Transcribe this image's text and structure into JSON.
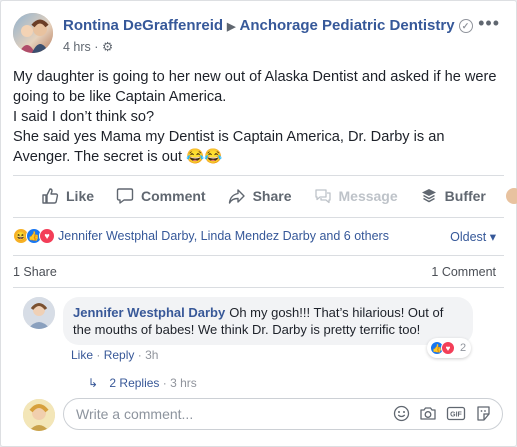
{
  "post": {
    "author": "Rontina DeGraffenreid",
    "page": "Anchorage Pediatric Dentistry",
    "time": "4 hrs",
    "privacy_separator": "·",
    "body_lines": [
      "My daughter is going to her new out of Alaska Dentist and asked if he were going to be like Captain America.",
      "I said I don’t think so?",
      "She said yes Mama my Dentist is Captain America, Dr. Darby is an Avenger. The secret is out 😂😂"
    ]
  },
  "actions": {
    "like": "Like",
    "comment": "Comment",
    "share": "Share",
    "message": "Message",
    "buffer": "Buffer"
  },
  "reactions": {
    "summary": "Jennifer Westphal Darby, Linda Mendez Darby and 6 others",
    "sort": "Oldest ▾"
  },
  "counts": {
    "shares": "1 Share",
    "comments": "1 Comment"
  },
  "comment": {
    "author": "Jennifer Westphal Darby",
    "text": "Oh my gosh!!! That’s hilarious! Out of the mouths of babes! We think Dr. Darby is pretty terrific too!",
    "like": "Like",
    "reply": "Reply",
    "time": "3h",
    "sep": "·",
    "reaction_count": "2",
    "replies": "2 Replies",
    "replies_time": "3 hrs"
  },
  "composer": {
    "placeholder": "Write a comment..."
  },
  "colors": {
    "link": "#365899",
    "muted": "#606770",
    "like_blue": "#1877f2",
    "love_red": "#f33e58",
    "haha_yellow": "#f7b125"
  }
}
